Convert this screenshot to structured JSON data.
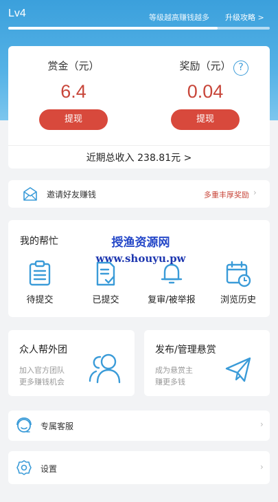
{
  "header": {
    "level": "Lv4",
    "hint": "等级越高赚钱越多",
    "upgrade_link": "升级攻略 >",
    "progress": 0.8
  },
  "earnings": {
    "bounty_title": "赏金（元）",
    "bounty_value": "6.4",
    "reward_title": "奖励（元）",
    "reward_value": "0.04",
    "help_icon": "?",
    "withdraw_label": "提现",
    "total_income": "近期总收入  238.81元  >"
  },
  "invite": {
    "label": "邀请好友赚钱",
    "reward_text": "多重丰厚奖励",
    "icon": "envelope-icon"
  },
  "my_help": {
    "title": "我的帮忙",
    "items": [
      {
        "label": "待提交",
        "icon": "clipboard-list-icon"
      },
      {
        "label": "已提交",
        "icon": "document-check-icon"
      },
      {
        "label": "复审/被举报",
        "icon": "bell-icon"
      },
      {
        "label": "浏览历史",
        "icon": "calendar-clock-icon"
      }
    ]
  },
  "watermark": {
    "line1": "授渔资源网",
    "line2": "www.shouyu.pw"
  },
  "features": {
    "team_title": "众人帮外团",
    "team_sub1": "加入官方团队",
    "team_sub2": "更多赚钱机会",
    "bounty_title": "发布/管理悬赏",
    "bounty_sub1": "成为悬赏主",
    "bounty_sub2": "赚更多钱"
  },
  "menu": {
    "service_label": "专属客服",
    "settings_label": "设置"
  },
  "colors": {
    "accent_blue": "#3a9bd8",
    "accent_red": "#d8493c"
  }
}
